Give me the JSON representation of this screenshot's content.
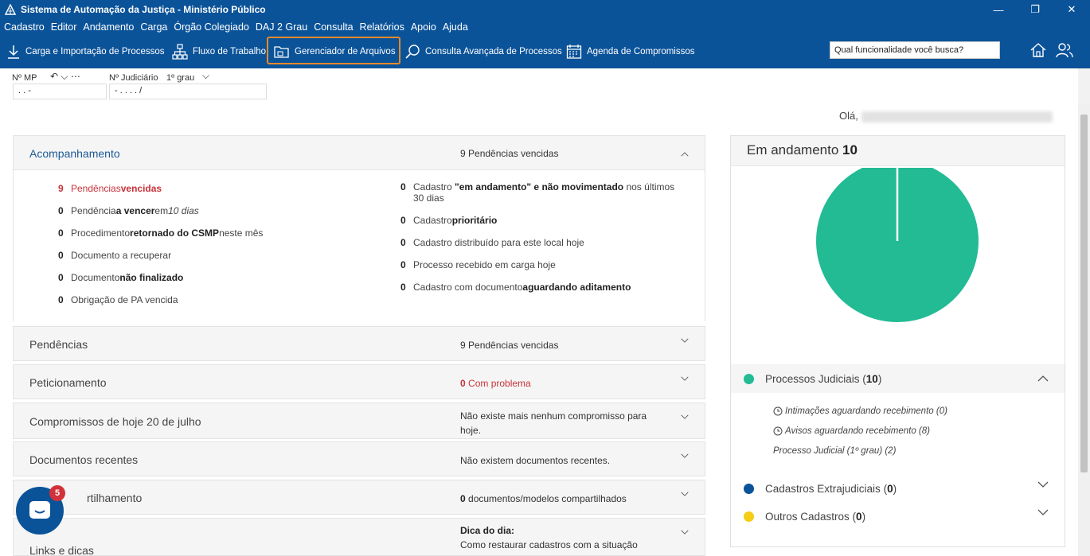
{
  "window": {
    "title": "Sistema de Automação da Justiça - Ministério Público"
  },
  "menu": [
    "Cadastro",
    "Editor",
    "Andamento",
    "Carga",
    "Órgão Colegiado",
    "DAJ 2 Grau",
    "Consulta",
    "Relatórios",
    "Apoio",
    "Ajuda"
  ],
  "toolbar": {
    "carga": "Carga e Importação de Processos",
    "fluxo": "Fluxo de Trabalho",
    "gerenciador": "Gerenciador de Arquivos",
    "consulta": "Consulta Avançada de Processos",
    "agenda": "Agenda de Compromissos",
    "search_value": "Qual funcionalidade você busca?"
  },
  "mp": {
    "mp_label": "Nº MP",
    "mp_value": ".   .      -",
    "jud_label": "Nº Judiciário",
    "grau": "1º grau",
    "jud_value": "-   .   .   .   .   /"
  },
  "greeting": "Olá,",
  "acompanhamento": {
    "title": "Acompanhamento",
    "status_count": "9",
    "status_text": "Pendências vencidas",
    "left": [
      {
        "n": "9",
        "pre": "Pendências ",
        "bold": "vencidas",
        "post": ""
      },
      {
        "n": "0",
        "pre": "Pendência ",
        "bold": "a vencer",
        "post": " em ",
        "ital": "10 dias"
      },
      {
        "n": "0",
        "pre": "Procedimento ",
        "bold": "retornado do CSMP",
        "post": " neste mês"
      },
      {
        "n": "0",
        "pre": "Documento a recuperar",
        "bold": "",
        "post": ""
      },
      {
        "n": "0",
        "pre": "Documento ",
        "bold": "não finalizado",
        "post": ""
      },
      {
        "n": "0",
        "pre": "Obrigação de PA vencida",
        "bold": "",
        "post": ""
      }
    ],
    "right": [
      {
        "n": "0",
        "pre": "Cadastro ",
        "bold": "\"em andamento\" e não movimentado",
        "post": " nos últimos",
        "line2": "30 dias"
      },
      {
        "n": "0",
        "pre": "Cadastro ",
        "bold": "prioritário",
        "post": ""
      },
      {
        "n": "0",
        "pre": "Cadastro distribuído para este local hoje",
        "bold": "",
        "post": ""
      },
      {
        "n": "0",
        "pre": "Processo recebido em carga hoje",
        "bold": "",
        "post": ""
      },
      {
        "n": "0",
        "pre": "Cadastro com documento ",
        "bold": "aguardando aditamento",
        "post": ""
      }
    ]
  },
  "pendencias": {
    "title": "Pendências",
    "count": "9",
    "text": "Pendências vencidas"
  },
  "peticionamento": {
    "title": "Peticionamento",
    "count": "0",
    "text": "Com problema"
  },
  "compromissos": {
    "title": "Compromissos de hoje 20 de julho",
    "line1": "Não existe mais nenhum compromisso para",
    "line2": "hoje."
  },
  "documentos": {
    "title": "Documentos recentes",
    "text": "Não existem documentos recentes."
  },
  "compartilhamento": {
    "title": "Compartilhamento",
    "visible_title": "rtilhamento",
    "count": "0",
    "text": "documentos/modelos compartilhados"
  },
  "links": {
    "title": "Links e dicas",
    "tip_label": "Dica do dia:",
    "tip_text": "Como restaurar cadastros com a situação"
  },
  "chat_badge": "5",
  "andamento": {
    "label": "Em andamento",
    "total": "10",
    "colors": {
      "judiciais": "#22bb94",
      "extrajudiciais": "#0b5399",
      "outros": "#f5cd16"
    },
    "groups": [
      {
        "name": "Processos Judiciais",
        "count": "10"
      },
      {
        "name": "Cadastros Extrajudiciais",
        "count": "0"
      },
      {
        "name": "Outros Cadastros",
        "count": "0"
      }
    ],
    "sub": [
      "Intimações aguardando recebimento (0)",
      "Avisos aguardando recebimento (8)",
      "Processo Judicial (1º grau) (2)"
    ]
  },
  "chart_data": {
    "type": "pie",
    "categories": [
      "Processos Judiciais",
      "Cadastros Extrajudiciais",
      "Outros Cadastros"
    ],
    "values": [
      10,
      0,
      0
    ],
    "title": "Em andamento 10"
  }
}
